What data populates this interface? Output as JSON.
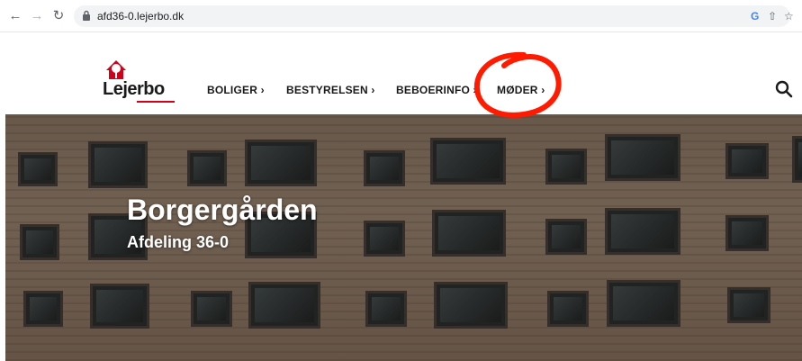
{
  "browser": {
    "back_icon": "arrow-left-icon",
    "forward_icon": "arrow-right-icon",
    "reload_icon": "reload-icon",
    "url": "afd36-0.lejerbo.dk",
    "right_icons": [
      "google-icon",
      "share-icon",
      "star-icon"
    ]
  },
  "header": {
    "logo_text": "Lejerbo",
    "nav": [
      {
        "label": "BOLIGER ›"
      },
      {
        "label": "BESTYRELSEN ›"
      },
      {
        "label": "BEBOERINFO ›"
      },
      {
        "label": "MØDER ›"
      }
    ],
    "search_icon": "search-icon"
  },
  "hero": {
    "title": "Borgergården",
    "subtitle": "Afdeling 36-0"
  },
  "colors": {
    "brand_red": "#d0021b",
    "annotation_red": "#ff1a00"
  }
}
